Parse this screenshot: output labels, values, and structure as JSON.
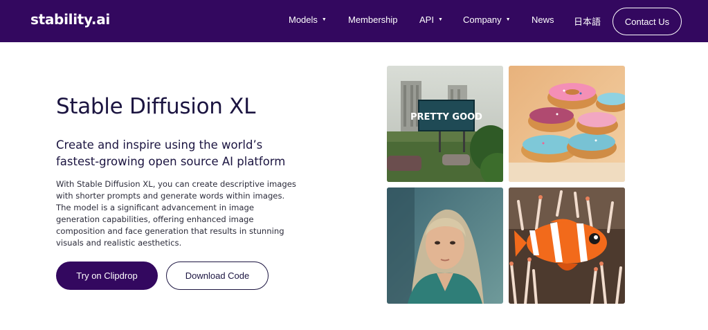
{
  "brand": {
    "logo_text": "stability.ai"
  },
  "nav": {
    "items": [
      {
        "label": "Models",
        "has_dropdown": true
      },
      {
        "label": "Membership",
        "has_dropdown": false
      },
      {
        "label": "API",
        "has_dropdown": true
      },
      {
        "label": "Company",
        "has_dropdown": true
      },
      {
        "label": "News",
        "has_dropdown": false
      },
      {
        "label": "日本語",
        "has_dropdown": false
      }
    ],
    "contact_label": "Contact Us"
  },
  "hero": {
    "title": "Stable Diffusion XL",
    "subtitle": "Create and inspire using the world’s fastest-growing open source AI platform",
    "body": "With Stable Diffusion XL, you can create descriptive images with shorter prompts and generate words within images. The model is a significant advancement in image generation capabilities, offering enhanced image composition and face generation that results in stunning visuals and realistic aesthetics.",
    "primary_cta": "Try on Clipdrop",
    "secondary_cta": "Download Code"
  },
  "gallery": {
    "images": [
      {
        "name": "billboard-image",
        "billboard_text": "PRETTY GOOD"
      },
      {
        "name": "donuts-image"
      },
      {
        "name": "portrait-image"
      },
      {
        "name": "clownfish-image"
      }
    ]
  },
  "colors": {
    "brand_purple": "#33085f",
    "text_dark": "#1b1440",
    "white": "#ffffff"
  }
}
